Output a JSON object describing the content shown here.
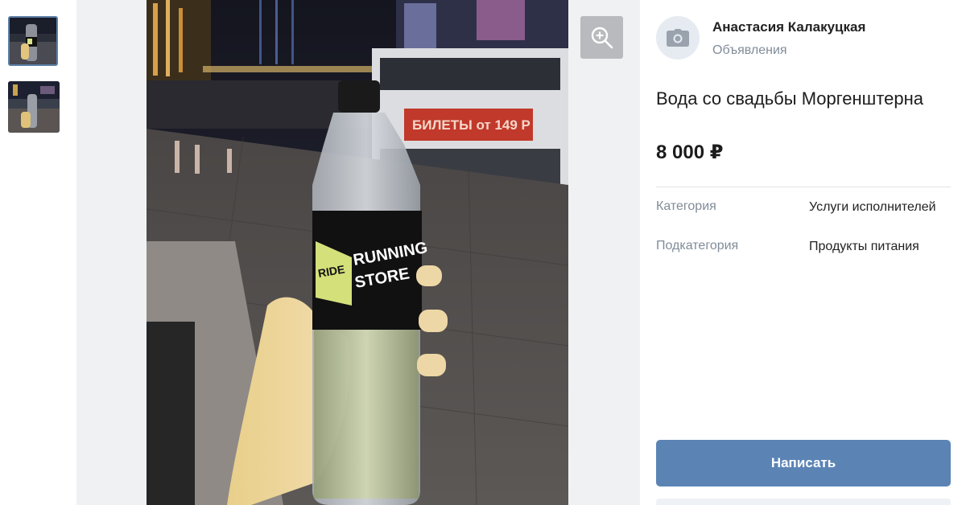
{
  "author": {
    "name": "Анастасия Калакуцкая",
    "subtitle": "Объявления"
  },
  "listing": {
    "title": "Вода со свадьбы Моргенштерна",
    "price": "8 000 ₽"
  },
  "properties": [
    {
      "label": "Категория",
      "value": "Услуги исполнителей"
    },
    {
      "label": "Подкатегория",
      "value": "Продукты питания"
    }
  ],
  "photo_text": {
    "boat_sign": "БИЛЕТЫ от 149 Р",
    "label_brand_small": "RIDE",
    "label_brand_line1": "RUNNING",
    "label_brand_line2": "STORE"
  },
  "actions": {
    "write_label": "Написать"
  },
  "colors": {
    "accent": "#5b84b5",
    "thumb_selected_border": "#5b7fa6",
    "muted_text": "#818c99"
  },
  "icons": {
    "zoom": "zoom-in-icon",
    "avatar": "camera-icon"
  }
}
